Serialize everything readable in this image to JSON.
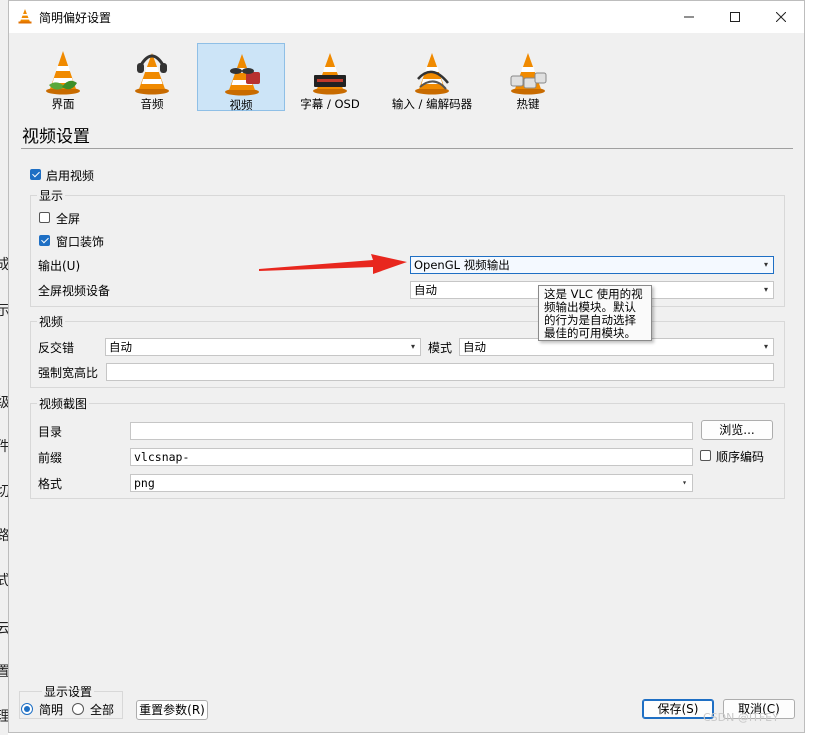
{
  "window": {
    "title": "简明偏好设置"
  },
  "categories": [
    {
      "label": "界面",
      "selected": false
    },
    {
      "label": "音频",
      "selected": false
    },
    {
      "label": "视频",
      "selected": true
    },
    {
      "label": "字幕 / OSD",
      "selected": false
    },
    {
      "label": "输入 / 编解码器",
      "selected": false
    },
    {
      "label": "热键",
      "selected": false
    }
  ],
  "section_title": "视频设置",
  "enable_video": {
    "label": "启用视频",
    "checked": true
  },
  "display": {
    "group_label": "显示",
    "fullscreen": {
      "label": "全屏",
      "checked": false
    },
    "decorations": {
      "label": "窗口装饰",
      "checked": true
    },
    "output_label": "输出(U)",
    "output_value": "OpenGL 视频输出",
    "fs_device_label": "全屏视频设备",
    "fs_device_value": "自动"
  },
  "tooltip": {
    "lines": [
      "这是 VLC 使用的视",
      "频输出模块。默认",
      "的行为是自动选择",
      "最佳的可用模块。"
    ]
  },
  "video": {
    "group_label": "视频",
    "deinterlace_label": "反交错",
    "deinterlace_value": "自动",
    "mode_label": "模式",
    "mode_value": "自动",
    "aspect_label": "强制宽高比",
    "aspect_value": ""
  },
  "snapshot": {
    "group_label": "视频截图",
    "dir_label": "目录",
    "dir_value": "",
    "browse_label": "浏览...",
    "prefix_label": "前缀",
    "prefix_value": "vlcsnap-",
    "sequential": {
      "label": "顺序编码",
      "checked": false
    },
    "format_label": "格式",
    "format_value": "png"
  },
  "footer": {
    "show_settings_label": "显示设置",
    "simple_label": "简明",
    "all_label": "全部",
    "reset_label": "重置参数(R)",
    "save_label": "保存(S)",
    "cancel_label": "取消(C)"
  },
  "background_glyphs": [
    "成",
    "示",
    "级",
    "件",
    "切",
    "路",
    "式",
    "云",
    "置",
    "理"
  ],
  "watermark": "CSDN @ITFEY",
  "colors": {
    "accent": "#1e6fc4",
    "selected_bg": "#cce4f7",
    "arrow": "#e8271e",
    "vlc_orange": "#f08a00"
  }
}
